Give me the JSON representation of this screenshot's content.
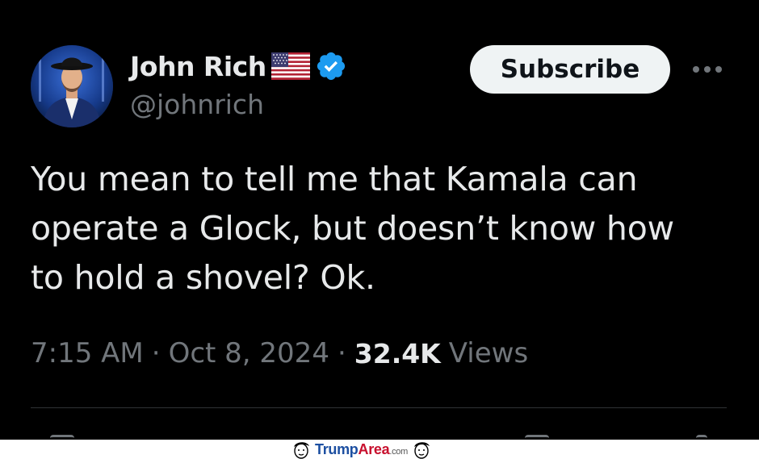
{
  "tweet": {
    "author": {
      "display_name": "John Rich",
      "handle": "@johnrich",
      "verified": true
    },
    "subscribe_label": "Subscribe",
    "text_lines": [
      "You mean to tell me that Kamala can",
      "operate a Glock, but doesn’t know how",
      "to hold a shovel? Ok."
    ],
    "time": "7:15 AM",
    "date": "Oct 8, 2024",
    "separator": "·",
    "views_count": "32.4K",
    "views_label": "Views"
  },
  "icons": {
    "flag": "us-flag-icon",
    "verified": "verified-badge-icon",
    "more": "more-options-icon"
  },
  "colors": {
    "background": "#000000",
    "primary_text": "#e7e9ea",
    "secondary_text": "#71767b",
    "verified_blue": "#1d9bf0",
    "subscribe_bg": "#eff3f4"
  },
  "watermark": {
    "brand_trump": "Trump",
    "brand_area": "Area",
    "brand_com": ".com"
  }
}
